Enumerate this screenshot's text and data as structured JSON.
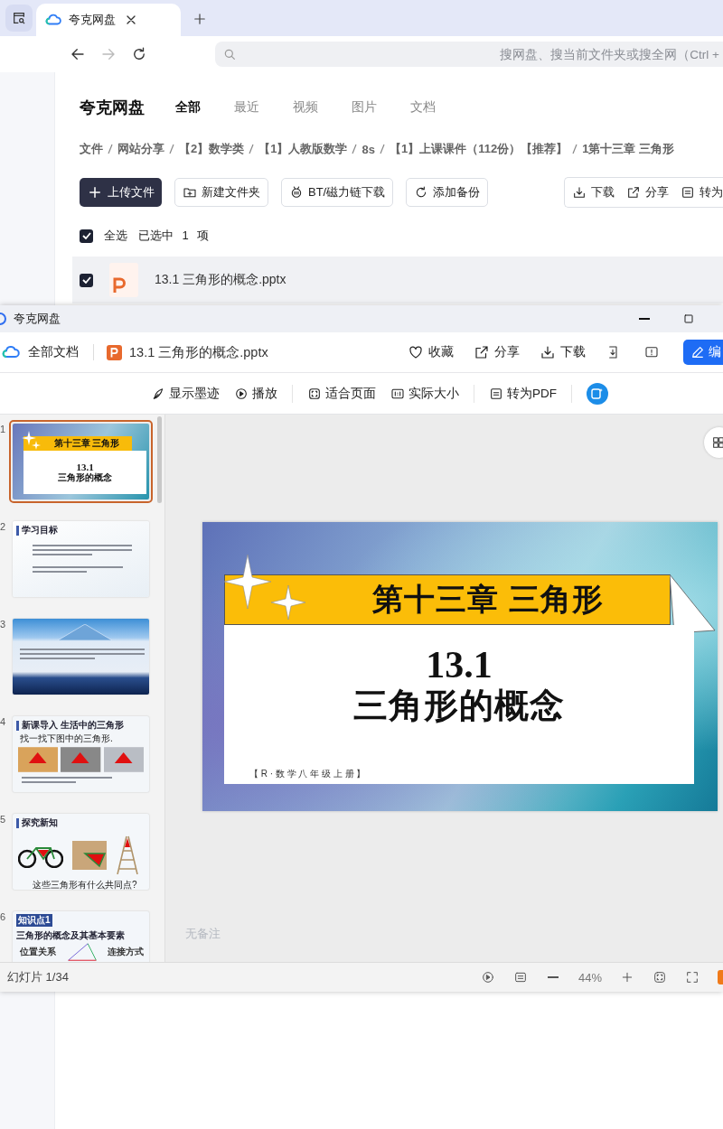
{
  "browser": {
    "tab": {
      "title": "夸克网盘",
      "selected": true
    },
    "search_placeholder": "搜网盘、搜当前文件夹或搜全网（Ctrl +"
  },
  "drive": {
    "brand": "夸克网盘",
    "tabs": [
      {
        "label": "全部",
        "selected": true
      },
      {
        "label": "最近",
        "selected": false
      },
      {
        "label": "视频",
        "selected": false
      },
      {
        "label": "图片",
        "selected": false
      },
      {
        "label": "文档",
        "selected": false
      }
    ],
    "breadcrumb": [
      "文件",
      "网站分享",
      "【2】数学类",
      "【1】人教版数学",
      "8s",
      "【1】上课课件（112份）【推荐】",
      "1第十三章 三角形"
    ],
    "actions": [
      {
        "label": "上传文件",
        "kind": "primary"
      },
      {
        "label": "新建文件夹",
        "kind": "outline"
      },
      {
        "label": "BT/磁力链下载",
        "kind": "outline"
      },
      {
        "label": "添加备份",
        "kind": "outline"
      }
    ],
    "selection_actions": [
      "下载",
      "分享",
      "转为"
    ],
    "select_all": {
      "label": "全选",
      "checked": true
    },
    "selection_summary": "已选中 1 项",
    "files": [
      {
        "name": "13.1 三角形的概念.pptx",
        "checked": true
      }
    ]
  },
  "viewer": {
    "window_title": "夸克网盘",
    "nav_label": "全部文档",
    "file_name": "13.1 三角形的概念.pptx",
    "header_actions": [
      "收藏",
      "分享",
      "下载"
    ],
    "edit_button": "编",
    "tools": [
      "显示墨迹",
      "播放",
      "适合页面",
      "实际大小",
      "转为PDF"
    ],
    "slides": [
      {
        "number": "1",
        "selected": true,
        "kind": "title",
        "banner": "第十三章 三角形",
        "heading": "13.1",
        "subtitle": "三角形的概念"
      },
      {
        "number": "2",
        "selected": false,
        "kind": "objectives",
        "heading": "学习目标"
      },
      {
        "number": "3",
        "selected": false,
        "kind": "pyramid"
      },
      {
        "number": "4",
        "selected": false,
        "kind": "photos",
        "heading": "新课导入 生活中的三角形",
        "lines": [
          "找一找下图中的三角形."
        ]
      },
      {
        "number": "5",
        "selected": false,
        "kind": "objects",
        "heading": "探究新知",
        "lines": [
          "这些三角形有什么共同点?"
        ]
      },
      {
        "number": "6",
        "selected": false,
        "kind": "triangle",
        "badge": "知识点1",
        "heading": "三角形的概念及其基本要素",
        "lines": [
          "位置关系",
          "连接方式"
        ]
      }
    ],
    "current_slide": {
      "banner": "第十三章 三角形",
      "heading": "13.1",
      "subtitle": "三角形的概念",
      "footer": "【 R · 数 学 八 年 级 上 册 】"
    },
    "notes_placeholder": "无备注",
    "status": "幻灯片 1/34",
    "zoom": "44%"
  }
}
